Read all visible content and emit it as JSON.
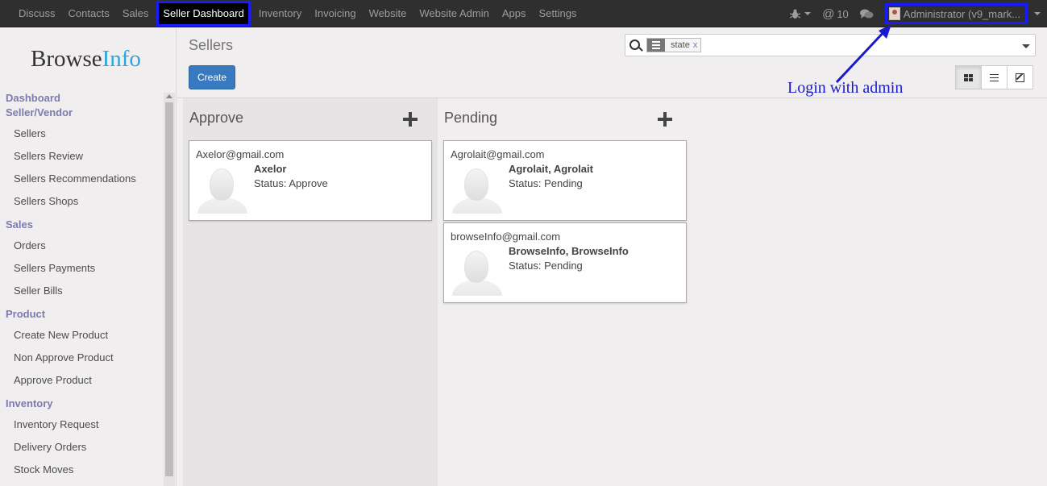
{
  "topnav": {
    "items": [
      {
        "label": "Discuss"
      },
      {
        "label": "Contacts"
      },
      {
        "label": "Sales"
      },
      {
        "label": "Seller Dashboard"
      },
      {
        "label": "Inventory"
      },
      {
        "label": "Invoicing"
      },
      {
        "label": "Website"
      },
      {
        "label": "Website Admin"
      },
      {
        "label": "Apps"
      },
      {
        "label": "Settings"
      }
    ],
    "active": "Seller Dashboard",
    "bug_icon": "bug-icon",
    "mentions_count": "10",
    "chat_icon": "chat-bubbles-icon",
    "user_label": "Administrator (v9_mark..."
  },
  "sidebar": {
    "logo_main": "Browse",
    "logo_accent": "Info",
    "sections": [
      {
        "header": "Dashboard",
        "items": []
      },
      {
        "header": "Seller/Vendor",
        "items": [
          "Sellers",
          "Sellers Review",
          "Sellers Recommendations",
          "Sellers Shops"
        ]
      },
      {
        "header": "Sales",
        "items": [
          "Orders",
          "Sellers Payments",
          "Seller Bills"
        ]
      },
      {
        "header": "Product",
        "items": [
          "Create New Product",
          "Non Approve Product",
          "Approve Product"
        ]
      },
      {
        "header": "Inventory",
        "items": [
          "Inventory Request",
          "Delivery Orders",
          "Stock Moves"
        ]
      }
    ]
  },
  "control": {
    "title": "Sellers",
    "create_label": "Create",
    "search_facet": "state",
    "facet_remove": "x"
  },
  "annotation": {
    "text": "Login with admin"
  },
  "kanban": {
    "columns": [
      {
        "title": "Approve",
        "cards": [
          {
            "email": "Axelor@gmail.com",
            "name": "Axelor",
            "status": "Status: Approve"
          }
        ]
      },
      {
        "title": "Pending",
        "cards": [
          {
            "email": "Agrolait@gmail.com",
            "name": "Agrolait, Agrolait",
            "status": "Status: Pending"
          },
          {
            "email": "browseInfo@gmail.com",
            "name": "BrowseInfo, BrowseInfo",
            "status": "Status: Pending"
          }
        ]
      }
    ]
  },
  "colors": {
    "navbar": "#2f2f2f",
    "highlight": "#1a1aff",
    "primary_button": "#3879c0",
    "sidebar_header": "#7c7bad"
  }
}
